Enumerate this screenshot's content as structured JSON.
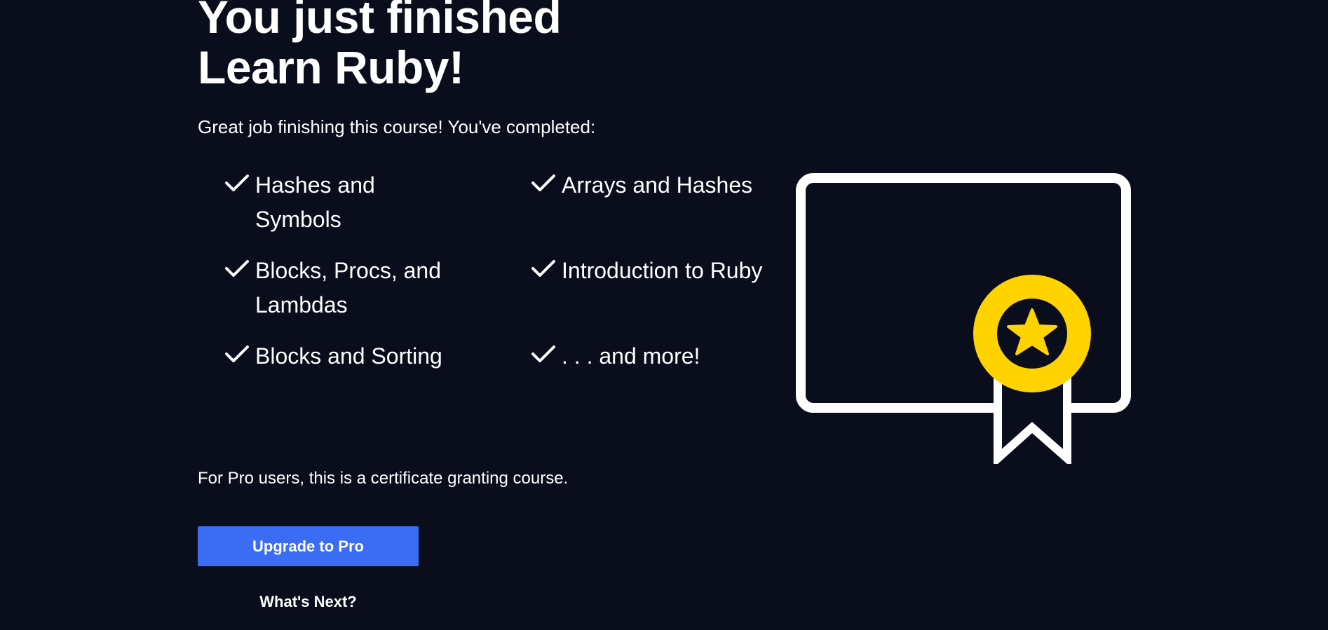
{
  "headline": {
    "line1": "You just finished",
    "line2": "Learn Ruby!"
  },
  "subtitle": "Great job finishing this course! You've completed:",
  "completed_items": [
    {
      "label": "Hashes and Symbols",
      "icon": "check-icon"
    },
    {
      "label": "Arrays and Hashes",
      "icon": "check-icon"
    },
    {
      "label": "Blocks, Procs, and Lambdas",
      "icon": "check-icon"
    },
    {
      "label": "Introduction to Ruby",
      "icon": "check-icon"
    },
    {
      "label": "Blocks and Sorting",
      "icon": "check-icon"
    },
    {
      "label": ". . . and more!",
      "icon": "check-icon"
    }
  ],
  "certificate": {
    "icon": "certificate-badge-icon",
    "badge_color": "#ffd300",
    "frame_color": "#ffffff"
  },
  "pro_note": "For Pro users, this is a certificate granting course.",
  "actions": {
    "upgrade_label": "Upgrade to Pro",
    "upgrade_color": "#3a6cf4",
    "whats_next_label": "What's Next?"
  },
  "theme": {
    "background": "#0a0d1c",
    "text": "#ffffff"
  }
}
